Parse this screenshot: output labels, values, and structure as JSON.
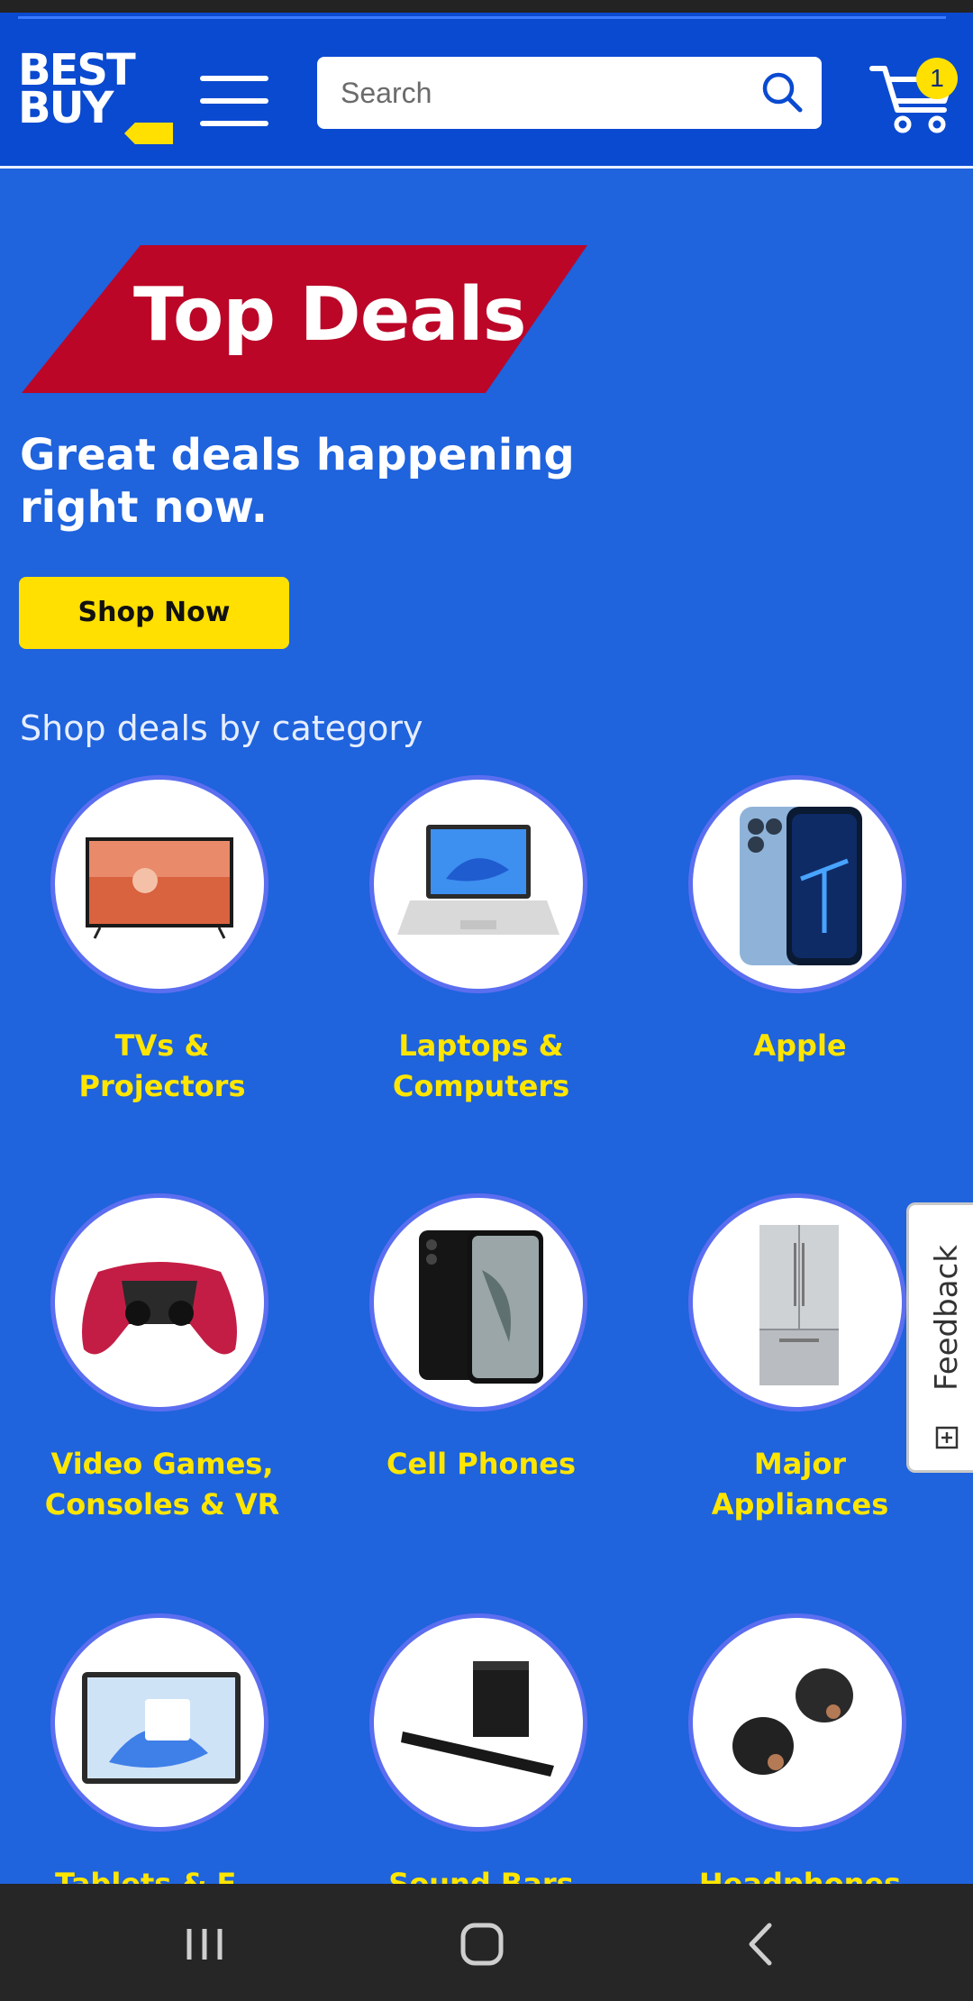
{
  "header": {
    "logo_line1": "BEST",
    "logo_line2": "BUY",
    "search_placeholder": "Search",
    "cart_count": "1"
  },
  "hero": {
    "title": "Top Deals",
    "subtitle": "Great deals happening right now.",
    "cta_label": "Shop Now"
  },
  "categories_section": {
    "title": "Shop deals by category",
    "items": [
      {
        "label": "TVs & Projectors",
        "icon": "tv-icon"
      },
      {
        "label": "Laptops & Computers",
        "icon": "laptop-icon"
      },
      {
        "label": "Apple",
        "icon": "iphone-icon"
      },
      {
        "label": "Video Games, Consoles & VR",
        "icon": "game-controller-icon"
      },
      {
        "label": "Cell Phones",
        "icon": "smartphone-icon"
      },
      {
        "label": "Major Appliances",
        "icon": "refrigerator-icon"
      },
      {
        "label": "Tablets & E...",
        "icon": "tablet-icon"
      },
      {
        "label": "Sound Bars",
        "icon": "soundbar-icon"
      },
      {
        "label": "Headphones",
        "icon": "earbuds-icon"
      }
    ]
  },
  "feedback_tab": {
    "label": "Feedback"
  },
  "colors": {
    "brand_blue": "#0a4ad0",
    "page_blue": "#1f63dd",
    "accent_yellow": "#ffe000",
    "deal_red": "#bb0628"
  }
}
